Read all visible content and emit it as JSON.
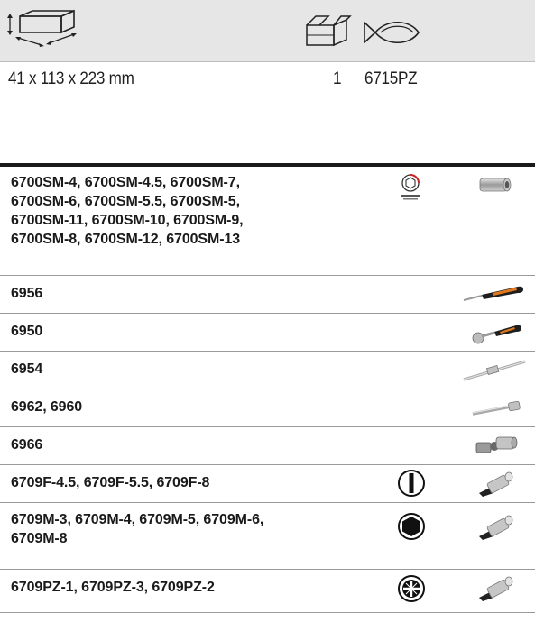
{
  "header": {
    "icons": [
      "dimensions-box-icon",
      "package-quantity-icon",
      "fish-reference-icon"
    ]
  },
  "spec": {
    "dimensions": "41 x 113 x 223 mm",
    "quantity": "1",
    "reference": "6715PZ"
  },
  "parts": [
    {
      "text": "6700SM-4, 6700SM-4.5, 6700SM-7,\n6700SM-6, 6700SM-5.5, 6700SM-5,\n6700SM-11, 6700SM-10, 6700SM-9,\n6700SM-8, 6700SM-12, 6700SM-13",
      "tip_icon": "hex-dynamic-drive-icon",
      "tool_icon": "socket-icon"
    },
    {
      "text": "6956",
      "tool_icon": "screwdriver-handle-icon"
    },
    {
      "text": "6950",
      "tool_icon": "ratchet-icon"
    },
    {
      "text": "6954",
      "tool_icon": "sliding-t-bar-icon"
    },
    {
      "text": "6962, 6960",
      "tool_icon": "extension-bar-icon"
    },
    {
      "text": "6966",
      "tool_icon": "universal-joint-icon"
    },
    {
      "text": "6709F-4.5, 6709F-5.5, 6709F-8",
      "tip_icon": "slotted-tip-icon",
      "tool_icon": "bit-socket-icon"
    },
    {
      "text": "6709M-3, 6709M-4, 6709M-5, 6709M-6,\n6709M-8",
      "tip_icon": "hex-tip-icon",
      "tool_icon": "bit-socket-icon"
    },
    {
      "text": "6709PZ-1, 6709PZ-3, 6709PZ-2",
      "tip_icon": "pozidriv-tip-icon",
      "tool_icon": "bit-socket-icon"
    }
  ]
}
